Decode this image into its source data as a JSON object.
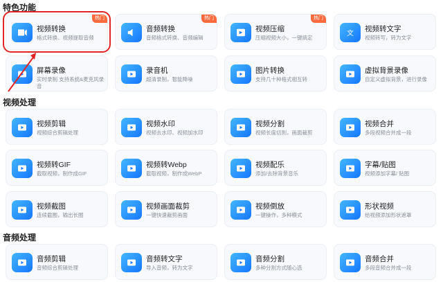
{
  "sections": {
    "featured": "特色功能",
    "video": "视频处理",
    "audio": "音频处理"
  },
  "cards": [
    {
      "title": "视频转换",
      "desc": "格式转换、视频提取音频",
      "badge": "热门",
      "icon": "video-convert-icon"
    },
    {
      "title": "音频转换",
      "desc": "音频格式转换、音频编辑",
      "badge": "热门",
      "icon": "audio-convert-icon"
    },
    {
      "title": "视频压缩",
      "desc": "压缩视频大小，一键搞定",
      "badge": "热门",
      "icon": "video-compress-icon"
    },
    {
      "title": "视频转文字",
      "desc": "视频转写，转为文字",
      "badge": "",
      "icon": "video-to-text-icon"
    },
    {
      "title": "屏幕录像",
      "desc": "实时录制 支持系统&麦克风录音",
      "badge": "",
      "icon": "screen-record-icon"
    },
    {
      "title": "录音机",
      "desc": "超清录制，智能降噪",
      "badge": "",
      "icon": "recorder-icon"
    },
    {
      "title": "图片转换",
      "desc": "支持几十种格式相互转",
      "badge": "",
      "icon": "image-convert-icon"
    },
    {
      "title": "虚拟背景录像",
      "desc": "自定义虚拟背景，进行录像",
      "badge": "",
      "icon": "virtual-bg-icon"
    },
    {
      "title": "视频剪辑",
      "desc": "视频综合剪辑处理",
      "badge": "",
      "icon": "video-edit-icon"
    },
    {
      "title": "视频水印",
      "desc": "视频去水印、视频加水印",
      "badge": "",
      "icon": "watermark-icon"
    },
    {
      "title": "视频分割",
      "desc": "视频长度切割，画面裁剪",
      "badge": "",
      "icon": "video-split-icon"
    },
    {
      "title": "视频合并",
      "desc": "多段视频合并成一段",
      "badge": "",
      "icon": "video-merge-icon"
    },
    {
      "title": "视频转GIF",
      "desc": "截取视频，制作成GIF",
      "badge": "",
      "icon": "gif-icon"
    },
    {
      "title": "视频转Webp",
      "desc": "截取视频，制作成WebP",
      "badge": "",
      "icon": "webp-icon"
    },
    {
      "title": "视频配乐",
      "desc": "添加/去除背景音乐",
      "badge": "",
      "icon": "music-icon"
    },
    {
      "title": "字幕/贴图",
      "desc": "视频添加字幕/ 贴图",
      "badge": "",
      "icon": "subtitle-icon"
    },
    {
      "title": "视频截图",
      "desc": "连续截图，输出长图",
      "badge": "",
      "icon": "screenshot-icon"
    },
    {
      "title": "视频画面裁剪",
      "desc": "一键快速裁剪画面",
      "badge": "",
      "icon": "crop-icon"
    },
    {
      "title": "视频倒放",
      "desc": "一键操作，多种模式",
      "badge": "",
      "icon": "reverse-icon"
    },
    {
      "title": "形状视频",
      "desc": "给视频添加形状遮罩",
      "badge": "",
      "icon": "shape-icon"
    },
    {
      "title": "音频剪辑",
      "desc": "音频综合剪辑处理",
      "badge": "",
      "icon": "audio-edit-icon"
    },
    {
      "title": "音频转文字",
      "desc": "导入音频，转为文字",
      "badge": "",
      "icon": "audio-to-text-icon"
    },
    {
      "title": "音频分割",
      "desc": "多种分割方式随心选",
      "badge": "",
      "icon": "audio-split-icon"
    },
    {
      "title": "音频合并",
      "desc": "多段音频合并成一段",
      "badge": "",
      "icon": "audio-merge-icon"
    }
  ]
}
